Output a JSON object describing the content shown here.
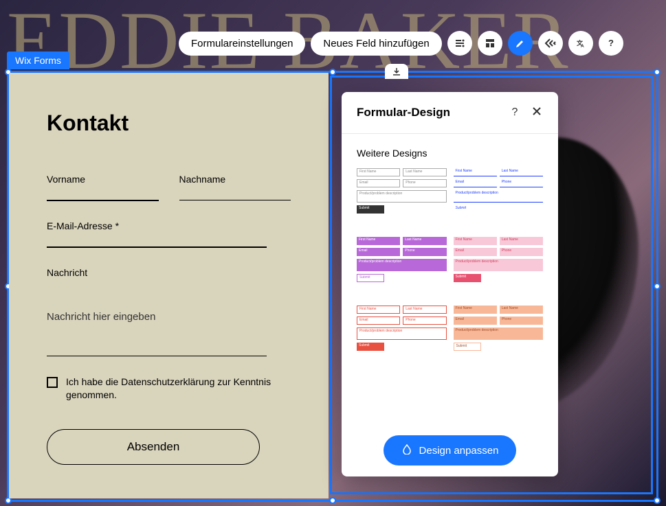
{
  "background": {
    "title": "EDDIE BAKER"
  },
  "toolbar": {
    "settings_label": "Formulareinstellungen",
    "add_field_label": "Neues Feld hinzufügen"
  },
  "selection": {
    "tag": "Wix Forms"
  },
  "form": {
    "title": "Kontakt",
    "first_name_label": "Vorname",
    "last_name_label": "Nachname",
    "email_label": "E-Mail-Adresse *",
    "message_label": "Nachricht",
    "message_placeholder": "Nachricht hier eingeben",
    "privacy_label": "Ich habe die Datenschutzerklärung zur Kenntnis genommen.",
    "submit_label": "Absenden"
  },
  "panel": {
    "title": "Formular-Design",
    "subtitle": "Weitere Designs",
    "customize_label": "Design anpassen",
    "card_labels": {
      "first": "First Name",
      "last": "Last Name",
      "email": "Email",
      "phone": "Phone",
      "desc": "Product/problem description",
      "submit": "Submit"
    }
  }
}
